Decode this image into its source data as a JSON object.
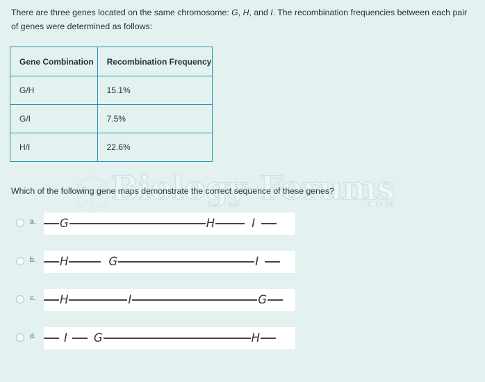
{
  "stem": {
    "part1": "There are three genes located on the same chromosome: ",
    "gene1": "G",
    "sep1": ", ",
    "gene2": "H",
    "sep2": ", and ",
    "gene3": "I",
    "part2": ". The recombination frequencies between each pair of genes were determined as follows:"
  },
  "table": {
    "headers": [
      "Gene Combination",
      "Recombination Frequency"
    ],
    "rows": [
      {
        "combination": "G/H",
        "frequency": "15.1%"
      },
      {
        "combination": "G/I",
        "frequency": "7.5%"
      },
      {
        "combination": "H/I",
        "frequency": "22.6%"
      }
    ]
  },
  "watermark": {
    "text": "Biology-Forums",
    "dotcom": ".COM"
  },
  "question": {
    "text": "Which of the following gene maps demonstrate the correct sequence of these genes?"
  },
  "options": [
    {
      "letter": "a.",
      "selected": false,
      "map": [
        {
          "type": "line",
          "length": 22
        },
        {
          "type": "label",
          "text": "G"
        },
        {
          "type": "line",
          "length": 196
        },
        {
          "type": "label",
          "text": "H"
        },
        {
          "type": "line",
          "length": 42
        },
        {
          "type": "gap",
          "length": 9
        },
        {
          "type": "label",
          "text": "I"
        },
        {
          "type": "gap",
          "length": 8
        },
        {
          "type": "line",
          "length": 22
        }
      ]
    },
    {
      "letter": "b.",
      "selected": false,
      "map": [
        {
          "type": "line",
          "length": 22
        },
        {
          "type": "label",
          "text": "H"
        },
        {
          "type": "line",
          "length": 46
        },
        {
          "type": "gap",
          "length": 10
        },
        {
          "type": "label",
          "text": "G"
        },
        {
          "type": "line",
          "length": 196
        },
        {
          "type": "label",
          "text": "I"
        },
        {
          "type": "gap",
          "length": 8
        },
        {
          "type": "line",
          "length": 22
        }
      ]
    },
    {
      "letter": "c.",
      "selected": false,
      "map": [
        {
          "type": "line",
          "length": 22
        },
        {
          "type": "label",
          "text": "H"
        },
        {
          "type": "line",
          "length": 84
        },
        {
          "type": "label",
          "text": "I"
        },
        {
          "type": "line",
          "length": 180
        },
        {
          "type": "label",
          "text": "G"
        },
        {
          "type": "line",
          "length": 22
        }
      ]
    },
    {
      "letter": "d.",
      "selected": false,
      "map": [
        {
          "type": "line",
          "length": 22
        },
        {
          "type": "gap",
          "length": 6
        },
        {
          "type": "label",
          "text": "I"
        },
        {
          "type": "gap",
          "length": 6
        },
        {
          "type": "line",
          "length": 22
        },
        {
          "type": "gap",
          "length": 8
        },
        {
          "type": "label",
          "text": "G"
        },
        {
          "type": "line",
          "length": 212
        },
        {
          "type": "label",
          "text": "H"
        },
        {
          "type": "line",
          "length": 22
        }
      ]
    }
  ]
}
